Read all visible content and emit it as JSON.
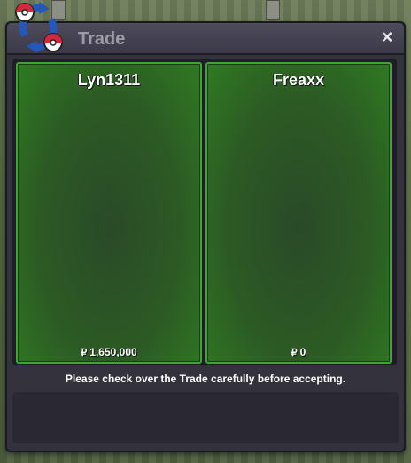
{
  "window": {
    "title": "Trade",
    "close_label": "×",
    "notice": "Please check over the Trade carefully before accepting."
  },
  "players": [
    {
      "name": "Lyn1311",
      "money": "1,650,000",
      "currency_symbol": "₽"
    },
    {
      "name": "Freaxx",
      "money": "0",
      "currency_symbol": "₽"
    }
  ],
  "icons": {
    "logo": "trade-swap-icon",
    "close": "close-icon",
    "currency": "pokedollar-icon"
  },
  "colors": {
    "panel_green": "#2f7a22",
    "panel_border": "#3fa532",
    "window_bg": "#33323d"
  }
}
